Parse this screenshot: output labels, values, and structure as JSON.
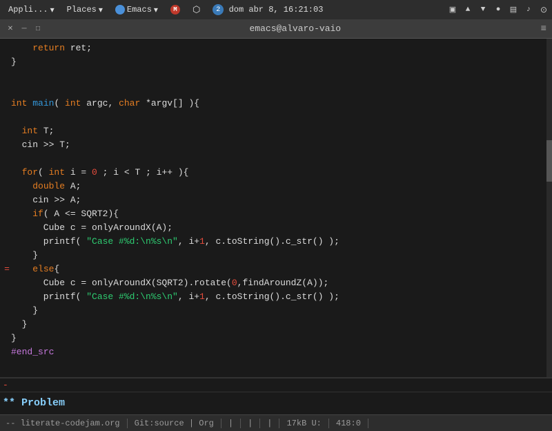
{
  "systemBar": {
    "appli": "Appli...",
    "places": "Places",
    "emacs": "Emacs",
    "gmail_icon": "M",
    "bluetooth": "B",
    "notifications": "2",
    "clock": "dom abr 8, 16:21:03",
    "monitor_icon": "▣",
    "network_icon": "▲",
    "user_icon": "●",
    "battery_icon": "▤",
    "volume_icon": "♪",
    "wifi_icon": "wifi"
  },
  "titleBar": {
    "close": "✕",
    "minimize": "─",
    "maximize": "□",
    "title": "emacs@alvaro-vaio",
    "menu": "≡"
  },
  "editor": {
    "lines": [
      {
        "marker": "",
        "content": [
          {
            "text": "    ",
            "class": "normal"
          },
          {
            "text": "return",
            "class": "kw"
          },
          {
            "text": " ret;",
            "class": "normal"
          }
        ]
      },
      {
        "marker": "",
        "content": [
          {
            "text": "}",
            "class": "normal"
          }
        ]
      },
      {
        "marker": "",
        "content": []
      },
      {
        "marker": "",
        "content": []
      },
      {
        "marker": "",
        "content": [
          {
            "text": "int",
            "class": "kw"
          },
          {
            "text": " ",
            "class": "normal"
          },
          {
            "text": "main",
            "class": "fn"
          },
          {
            "text": "( ",
            "class": "normal"
          },
          {
            "text": "int",
            "class": "kw"
          },
          {
            "text": " argc, ",
            "class": "normal"
          },
          {
            "text": "char",
            "class": "kw"
          },
          {
            "text": " *argv[] ){",
            "class": "normal"
          }
        ]
      },
      {
        "marker": "",
        "content": []
      },
      {
        "marker": "",
        "content": [
          {
            "text": "  ",
            "class": "normal"
          },
          {
            "text": "int",
            "class": "kw"
          },
          {
            "text": " T;",
            "class": "normal"
          }
        ]
      },
      {
        "marker": "",
        "content": [
          {
            "text": "  cin >> T;",
            "class": "normal"
          }
        ]
      },
      {
        "marker": "",
        "content": []
      },
      {
        "marker": "",
        "content": [
          {
            "text": "  ",
            "class": "normal"
          },
          {
            "text": "for",
            "class": "kw"
          },
          {
            "text": "( ",
            "class": "normal"
          },
          {
            "text": "int",
            "class": "kw"
          },
          {
            "text": " i = ",
            "class": "normal"
          },
          {
            "text": "0",
            "class": "num"
          },
          {
            "text": " ; i < T ; i++ ){",
            "class": "normal"
          }
        ]
      },
      {
        "marker": "",
        "content": [
          {
            "text": "    ",
            "class": "normal"
          },
          {
            "text": "double",
            "class": "kw"
          },
          {
            "text": " A;",
            "class": "normal"
          }
        ]
      },
      {
        "marker": "",
        "content": [
          {
            "text": "    cin >> A;",
            "class": "normal"
          }
        ]
      },
      {
        "marker": "",
        "content": [
          {
            "text": "    ",
            "class": "normal"
          },
          {
            "text": "if",
            "class": "kw"
          },
          {
            "text": "( A <= SQRT2){",
            "class": "normal"
          }
        ]
      },
      {
        "marker": "",
        "content": [
          {
            "text": "      Cube c = onlyAroundX(A);",
            "class": "normal"
          }
        ]
      },
      {
        "marker": "",
        "content": [
          {
            "text": "      printf( ",
            "class": "normal"
          },
          {
            "text": "\"Case #%d:\\n%s\\n\"",
            "class": "str"
          },
          {
            "text": ", i+",
            "class": "normal"
          },
          {
            "text": "1",
            "class": "num"
          },
          {
            "text": ", c.toString().c_str() );",
            "class": "normal"
          }
        ]
      },
      {
        "marker": "",
        "content": [
          {
            "text": "    }",
            "class": "normal"
          }
        ]
      },
      {
        "marker": "=",
        "content": [
          {
            "text": "    ",
            "class": "normal"
          },
          {
            "text": "else",
            "class": "kw"
          },
          {
            "text": "{",
            "class": "normal"
          }
        ]
      },
      {
        "marker": "",
        "content": [
          {
            "text": "      Cube c = onlyAroundX(SQRT2).rotate(",
            "class": "normal"
          },
          {
            "text": "0",
            "class": "num"
          },
          {
            "text": ",findAroundZ(A));",
            "class": "normal"
          }
        ]
      },
      {
        "marker": "",
        "content": [
          {
            "text": "      printf( ",
            "class": "normal"
          },
          {
            "text": "\"Case #%d:\\n%s\\n\"",
            "class": "str"
          },
          {
            "text": ", i+",
            "class": "normal"
          },
          {
            "text": "1",
            "class": "num"
          },
          {
            "text": ", c.toString().c_str() );",
            "class": "normal"
          }
        ]
      },
      {
        "marker": "",
        "content": [
          {
            "text": "    }",
            "class": "normal"
          }
        ]
      },
      {
        "marker": "",
        "content": [
          {
            "text": "  }",
            "class": "normal"
          }
        ]
      },
      {
        "marker": "",
        "content": [
          {
            "text": "}",
            "class": "normal"
          }
        ]
      },
      {
        "marker": "",
        "content": [
          {
            "text": "#end_src",
            "class": "pp"
          }
        ]
      }
    ]
  },
  "miniBar": {
    "marker": "-",
    "content": ""
  },
  "orgHeading": "** Problem",
  "statusBar": {
    "section1": "-- literate-codejam.org",
    "section2": "Git:source | Org",
    "section3": "|",
    "section4": "|",
    "section5": "|",
    "section6": "17kB U:",
    "section7": "418:0"
  }
}
